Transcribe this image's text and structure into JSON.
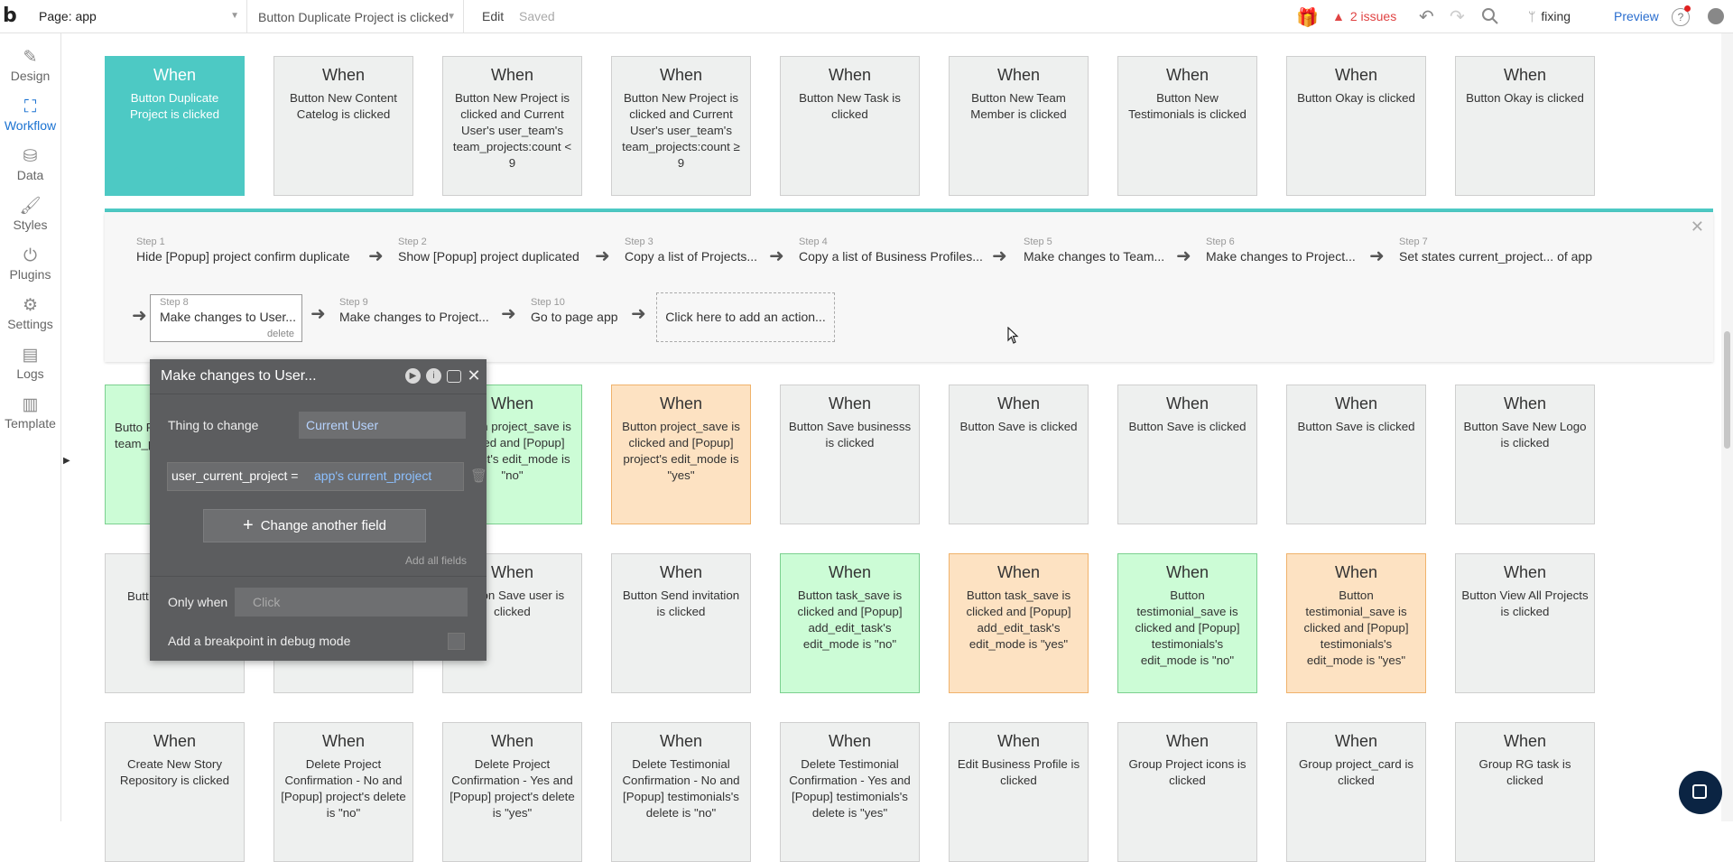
{
  "topbar": {
    "logo": "b",
    "page_select": "Page: app",
    "workflow_select": "Button Duplicate Project is clicked",
    "edit_menu": "Edit",
    "saved_status": "Saved",
    "issues": "2 issues",
    "branch": "fixing",
    "preview": "Preview"
  },
  "sidebar": {
    "items": [
      {
        "label": "Design",
        "icon": "design-icon"
      },
      {
        "label": "Workflow",
        "icon": "workflow-icon"
      },
      {
        "label": "Data",
        "icon": "database-icon"
      },
      {
        "label": "Styles",
        "icon": "brush-icon"
      },
      {
        "label": "Plugins",
        "icon": "plug-icon"
      },
      {
        "label": "Settings",
        "icon": "gear-icon"
      },
      {
        "label": "Logs",
        "icon": "document-icon"
      },
      {
        "label": "Template",
        "icon": "template-icon"
      }
    ],
    "active": "Workflow"
  },
  "canvas": {
    "row1": [
      {
        "when": "When",
        "text": "Button Duplicate Project is clicked",
        "color": "teal"
      },
      {
        "when": "When",
        "text": "Button New Content Catelog is clicked",
        "color": "gray"
      },
      {
        "when": "When",
        "text": "Button New Project is clicked and Current User's user_team's team_projects:count < 9",
        "color": "gray"
      },
      {
        "when": "When",
        "text": "Button New Project is clicked and Current User's user_team's team_projects:count ≥ 9",
        "color": "gray"
      },
      {
        "when": "When",
        "text": "Button New Task is clicked",
        "color": "gray"
      },
      {
        "when": "When",
        "text": "Button New Team Member is clicked",
        "color": "gray"
      },
      {
        "when": "When",
        "text": "Button New Testimonials is clicked",
        "color": "gray"
      },
      {
        "when": "When",
        "text": "Button Okay is clicked",
        "color": "gray"
      },
      {
        "when": "When",
        "text": "Button Okay is clicked",
        "color": "gray"
      }
    ],
    "row2": [
      {
        "when": "When",
        "text": "Button project_save is clicked and [Popup] project's edit_mode is \"no\"",
        "color": "green"
      },
      {
        "when": "When",
        "text": "Button project_save is clicked and [Popup] project's edit_mode is \"yes\"",
        "color": "orange"
      },
      {
        "when": "When",
        "text": "Button Save businesss is clicked",
        "color": "gray"
      },
      {
        "when": "When",
        "text": "Button Save is clicked",
        "color": "gray"
      },
      {
        "when": "When",
        "text": "Button Save is clicked",
        "color": "gray"
      },
      {
        "when": "When",
        "text": "Button Save is clicked",
        "color": "gray"
      },
      {
        "when": "When",
        "text": "Button Save New Logo is clicked",
        "color": "gray"
      }
    ],
    "row2_partial_first": {
      "text": "Butto Projec Cu u team_p",
      "color": "green"
    },
    "row3_partial": [
      {
        "text": "Butt Pho",
        "color": "gray"
      },
      {
        "text": "",
        "color": "gray"
      }
    ],
    "row3": [
      {
        "when": "When",
        "text": "Button Save user is clicked",
        "color": "gray"
      },
      {
        "when": "When",
        "text": "Button Send invitation is clicked",
        "color": "gray"
      },
      {
        "when": "When",
        "text": "Button task_save is clicked and [Popup] add_edit_task's edit_mode is \"no\"",
        "color": "green"
      },
      {
        "when": "When",
        "text": "Button task_save is clicked and [Popup] add_edit_task's edit_mode is \"yes\"",
        "color": "orange"
      },
      {
        "when": "When",
        "text": "Button testimonial_save is clicked and [Popup] testimonials's edit_mode is \"no\"",
        "color": "green"
      },
      {
        "when": "When",
        "text": "Button testimonial_save is clicked and [Popup] testimonials's edit_mode is \"yes\"",
        "color": "orange"
      },
      {
        "when": "When",
        "text": "Button View All Projects is clicked",
        "color": "gray"
      }
    ],
    "row4": [
      {
        "when": "When",
        "text": "Create New Story Repository is clicked",
        "color": "gray"
      },
      {
        "when": "When",
        "text": "Delete Project Confirmation - No and [Popup] project's delete is \"no\"",
        "color": "gray"
      },
      {
        "when": "When",
        "text": "Delete Project Confirmation - Yes and [Popup] project's delete is \"yes\"",
        "color": "gray"
      },
      {
        "when": "When",
        "text": "Delete Testimonial Confirmation - No and [Popup] testimonials's delete is \"no\"",
        "color": "gray"
      },
      {
        "when": "When",
        "text": "Delete Testimonial Confirmation - Yes and [Popup] testimonials's delete is \"yes\"",
        "color": "gray"
      },
      {
        "when": "When",
        "text": "Edit Business Profile is clicked",
        "color": "gray"
      },
      {
        "when": "When",
        "text": "Group Project icons is clicked",
        "color": "gray"
      },
      {
        "when": "When",
        "text": "Group project_card is clicked",
        "color": "gray"
      },
      {
        "when": "When",
        "text": "Group RG task is clicked",
        "color": "gray"
      }
    ]
  },
  "steps": {
    "items": [
      {
        "num": "Step 1",
        "label": "Hide [Popup] project confirm duplicate"
      },
      {
        "num": "Step 2",
        "label": "Show [Popup] project duplicated"
      },
      {
        "num": "Step 3",
        "label": "Copy a list of Projects..."
      },
      {
        "num": "Step 4",
        "label": "Copy a list of Business Profiles..."
      },
      {
        "num": "Step 5",
        "label": "Make changes to Team..."
      },
      {
        "num": "Step 6",
        "label": "Make changes to Project..."
      },
      {
        "num": "Step 7",
        "label": "Set states current_project... of app"
      },
      {
        "num": "Step 8",
        "label": "Make changes to User..."
      },
      {
        "num": "Step 9",
        "label": "Make changes to Project..."
      },
      {
        "num": "Step 10",
        "label": "Go to page app"
      }
    ],
    "delete_label": "delete",
    "add_action": "Click here to add an action..."
  },
  "editor": {
    "title": "Make changes to User...",
    "thing_label": "Thing to change",
    "thing_value": "Current User",
    "field_key": "user_current_project  =",
    "field_value": "app's current_project",
    "change_another": "Change another field",
    "add_all": "Add all fields",
    "only_when_label": "Only when",
    "only_when_placeholder": "Click",
    "breakpoint_label": "Add a breakpoint in debug mode"
  },
  "colors": {
    "teal": "#4dc9c4",
    "green": "#ccfcd6",
    "orange": "#fde2c2",
    "gray": "#eef0ef",
    "accent": "#1a72d1"
  }
}
